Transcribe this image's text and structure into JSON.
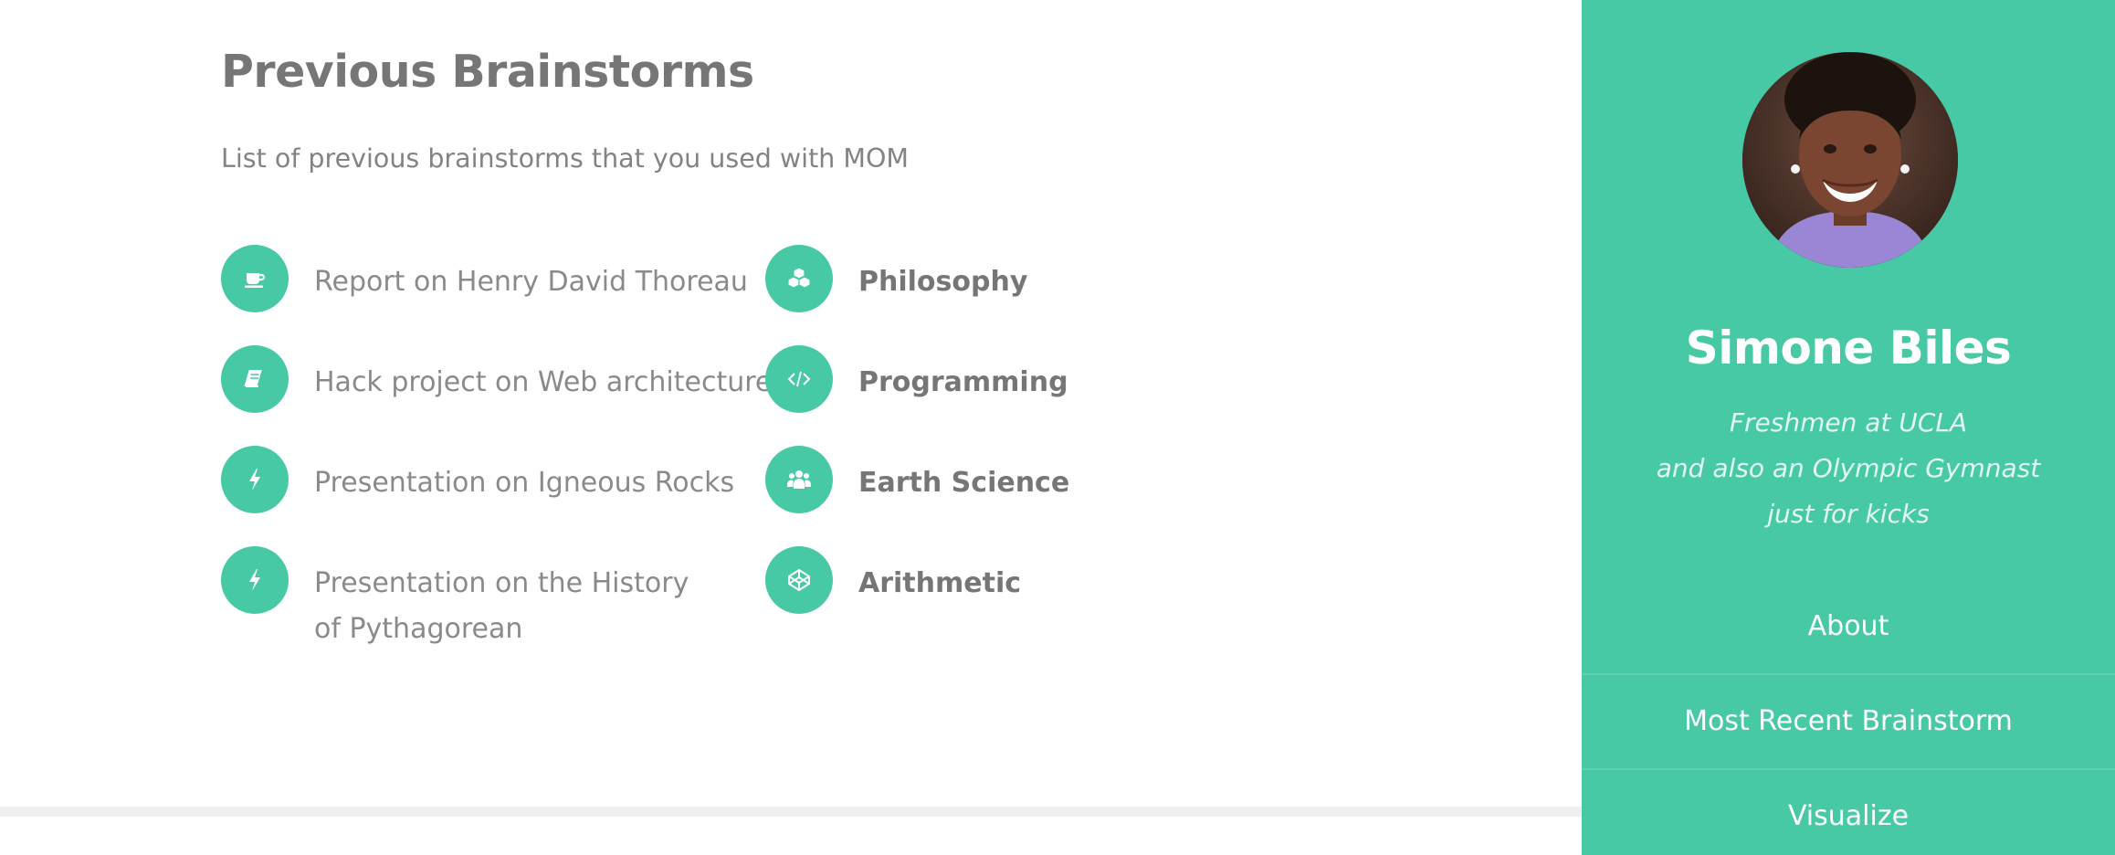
{
  "main": {
    "title": "Previous Brainstorms",
    "subtitle": "List of previous brainstorms that you used with MOM",
    "brainstorms": [
      {
        "label": "Report on Henry David Thoreau",
        "icon": "coffee-cup-icon"
      },
      {
        "label": "Hack project on Web architecture",
        "icon": "book-icon"
      },
      {
        "label": "Presentation on Igneous Rocks",
        "icon": "lightning-bolt-icon"
      },
      {
        "label": "Presentation on the History of Pythagorean",
        "icon": "lightning-bolt-icon"
      }
    ],
    "subjects": [
      {
        "label": "Philosophy",
        "icon": "cubes-icon"
      },
      {
        "label": "Programming",
        "icon": "code-icon"
      },
      {
        "label": "Earth Science",
        "icon": "group-icon"
      },
      {
        "label": "Arithmetic",
        "icon": "codepen-icon"
      }
    ],
    "accent_color": "#48c9a6"
  },
  "sidebar": {
    "name": "Simone Biles",
    "bio_line1": "Freshmen at UCLA",
    "bio_line2": "and also an Olympic Gymnast just for kicks",
    "nav": [
      {
        "label": "About"
      },
      {
        "label": "Most Recent Brainstorm"
      },
      {
        "label": "Visualize"
      }
    ],
    "background_color": "#48c9a6"
  }
}
